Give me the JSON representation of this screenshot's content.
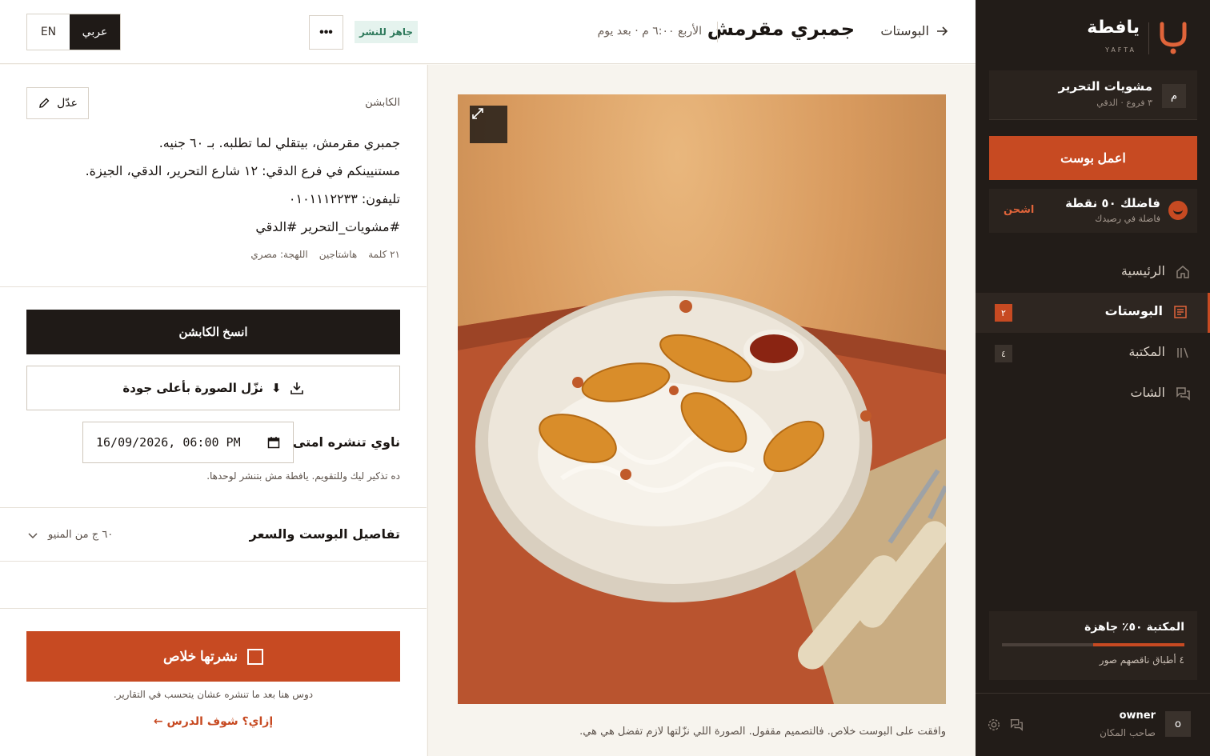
{
  "brand": {
    "name": "يافطة",
    "latin": "YAFTA"
  },
  "branch": {
    "badge": "م",
    "title": "مشويات التحرير",
    "sub": "٣ فروع · الدقي"
  },
  "sidebar": {
    "make_post": "اعمل بوست",
    "points": {
      "title": "فاضلك ٥٠ نقطة",
      "sub": "فاضلة في رصيدك",
      "charge": "اشحن"
    },
    "nav": [
      {
        "label": "الرئيسية",
        "icon": "home-icon",
        "count": ""
      },
      {
        "label": "البوستات",
        "icon": "posts-icon",
        "count": "٢",
        "active": true
      },
      {
        "label": "المكتبة",
        "icon": "library-icon",
        "count": "٤"
      },
      {
        "label": "الشات",
        "icon": "chat-icon",
        "count": ""
      }
    ],
    "library": {
      "title": "المكتبة ٥٠٪ جاهزة",
      "progress": 0.5,
      "sub": "٤ أطباق ناقصهم صور"
    },
    "owner": {
      "avatar": "o",
      "name": "owner",
      "role": "صاحب المكان"
    }
  },
  "topbar": {
    "back_label": "البوستات",
    "post_title": "جمبري مقرمش",
    "time": "الأربع ٦:٠٠ م · بعد يوم",
    "status": "جاهز للنشر",
    "more": "•••",
    "lang_en": "EN",
    "lang_ar": "عربي"
  },
  "image": {
    "approved_note": "وافقت على البوست خلاص. فالتصميم مقفول. الصورة اللي نزّلتها لازم تفضل هي هي."
  },
  "caption": {
    "label": "الكابشن",
    "edit": "عدّل",
    "lines": [
      "جمبري مقرمش، بيتقلي لما تطلبه. بـ ٦٠ جنيه.",
      "مستنيينكم في فرع الدقي: ١٢ شارع التحرير، الدقي، الجيزة.",
      "تليفون: ٠١٠١١١٢٢٣٣",
      "#مشويات_التحرير #الدقي"
    ],
    "meta": {
      "words": "٢١ كلمة",
      "hashtags": "هاشتاجين",
      "dialect": "اللهجة: مصري"
    }
  },
  "actions": {
    "copy": "انسخ الكابشن",
    "download": "نزّل الصورة بأعلى جودة",
    "download_glyph": "⬇",
    "schedule_label": "ناوي تنشره امتى",
    "schedule_value": "16/09/2026, 06:00 PM",
    "schedule_note": "ده تذكير ليك وللتقويم. يافطة مش بتنشر لوحدها.",
    "details_title": "تفاصيل البوست والسعر",
    "details_price": "٦٠ ج من المنيو",
    "published": "نشرتها خلاص",
    "published_note": "دوس هنا بعد ما تنشره عشان يتحسب في التقارير.",
    "lesson": "إزاي؟ شوف الدرس ←"
  },
  "colors": {
    "accent": "#c74a22",
    "sidebar_bg": "#221c18",
    "ready_bg": "#e5f3ee",
    "ready_text": "#2f7a5c"
  }
}
